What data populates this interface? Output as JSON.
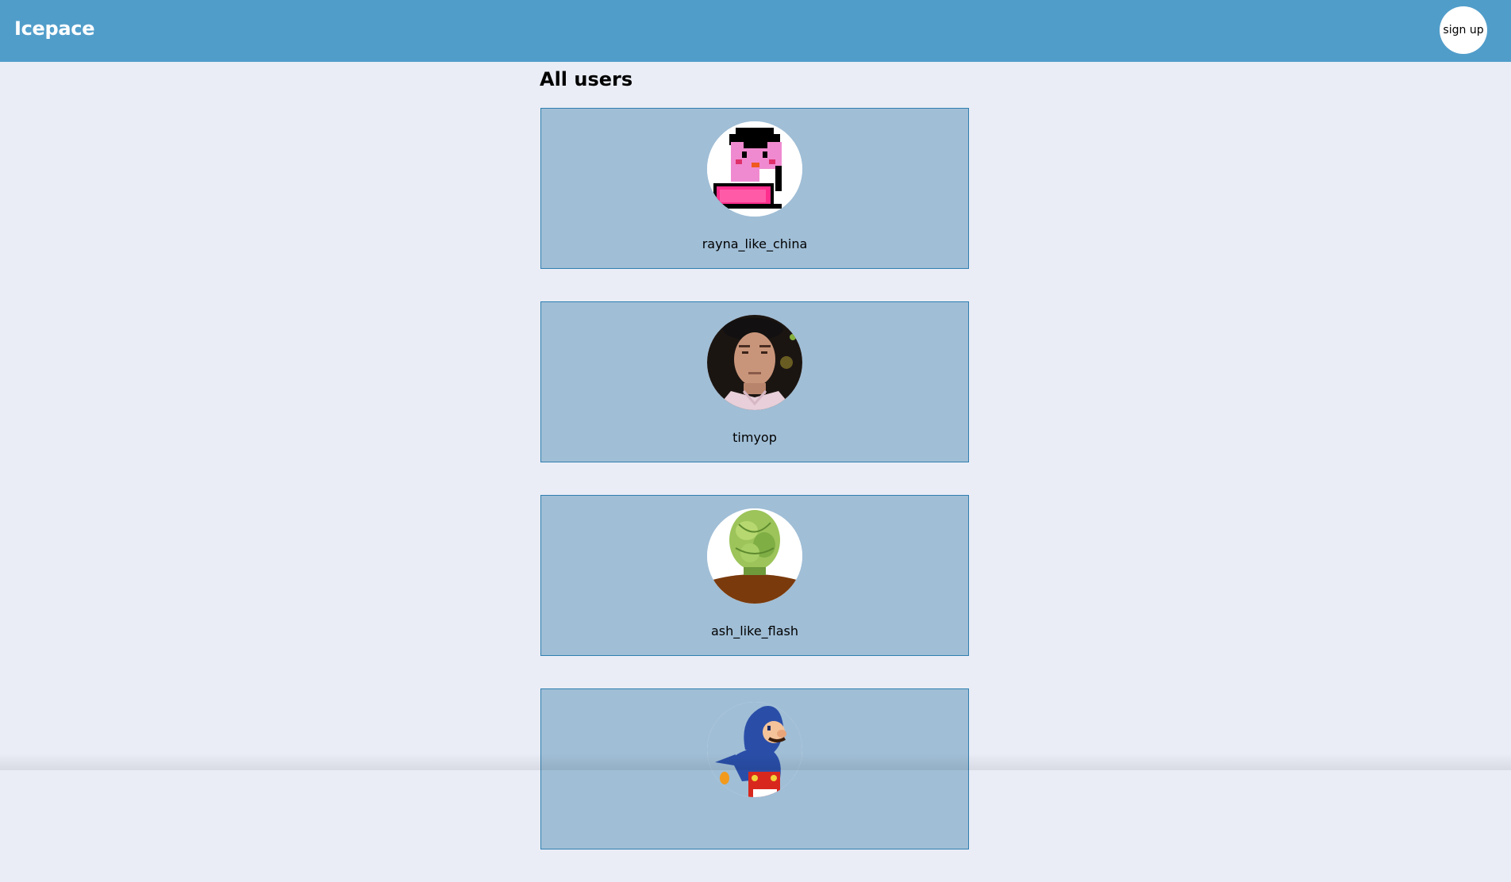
{
  "header": {
    "brand": "Icepace",
    "signup_label": "sign up"
  },
  "main": {
    "title": "All users",
    "users": [
      {
        "username": "rayna_like_china",
        "avatar": "pixel-penguin-avatar"
      },
      {
        "username": "timyop",
        "avatar": "man-portrait-avatar"
      },
      {
        "username": "ash_like_flash",
        "avatar": "lettuce-face-avatar"
      },
      {
        "username": "",
        "avatar": "penguin-suit-mario-avatar"
      }
    ]
  },
  "colors": {
    "header_bg": "#519dca",
    "page_bg": "#eaedf6",
    "card_bg": "#a0bed6",
    "card_border": "#2f7fb0"
  }
}
